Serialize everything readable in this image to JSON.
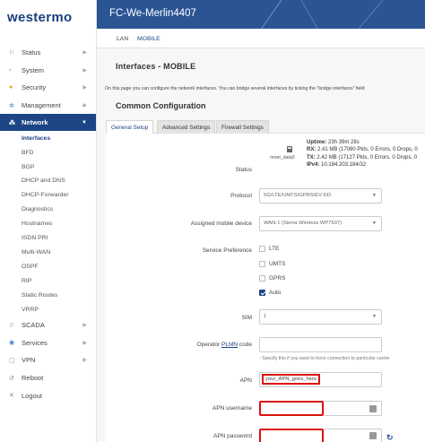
{
  "brand": "westermo",
  "header": {
    "hostname": "FC-We-Merlin4407"
  },
  "top_tabs": [
    "LAN",
    "MOBILE"
  ],
  "sidebar": {
    "items": [
      {
        "label": "Status",
        "icon": "status-icon",
        "glyph": "⚐"
      },
      {
        "label": "System",
        "icon": "system-icon",
        "glyph": "▫"
      },
      {
        "label": "Security",
        "icon": "security-icon",
        "glyph": "●"
      },
      {
        "label": "Management",
        "icon": "management-icon",
        "glyph": "✲"
      },
      {
        "label": "Network",
        "icon": "network-icon",
        "glyph": "⁂"
      }
    ],
    "network_sub": [
      "Interfaces",
      "BFD",
      "BGP",
      "DHCP and DNS",
      "DHCP-Forwarder",
      "Diagnostics",
      "Hostnames",
      "ISDN PRI",
      "Multi-WAN",
      "OSPF",
      "RIP",
      "Static Routes",
      "VRRP"
    ],
    "items_after": [
      {
        "label": "SCADA",
        "icon": "scada-icon",
        "glyph": "♫"
      },
      {
        "label": "Services",
        "icon": "services-icon",
        "glyph": "◉"
      },
      {
        "label": "VPN",
        "icon": "vpn-icon",
        "glyph": "▢"
      },
      {
        "label": "Reboot",
        "icon": "reboot-icon",
        "glyph": "↺"
      },
      {
        "label": "Logout",
        "icon": "logout-icon",
        "glyph": "✕"
      }
    ]
  },
  "page": {
    "title": "Interfaces - MOBILE",
    "description": "On this page you can configure the network interfaces. You can bridge several interfaces by ticking the \"bridge interfaces\" field",
    "section": "Common Configuration"
  },
  "subtabs": [
    "General Setup",
    "Advanced Settings",
    "Firewall Settings"
  ],
  "status": {
    "label": "Status",
    "interface": "mnet_data0",
    "uptime_label": "Uptime:",
    "uptime": "23h 39m 28s",
    "rx_label": "RX:",
    "rx": "2.41 MB (17080 Pkts, 0 Errors, 0 Drops, 0",
    "tx_label": "TX:",
    "tx": "2.42 MB (17127 Pkts, 0 Errors, 0 Drops, 0",
    "ipv4_label": "IPv4:",
    "ipv4": "10.184.203.184/32"
  },
  "form": {
    "protocol_label": "Protocol",
    "protocol_value": "5G/LTE/UMTS/GPRS/EV-DO",
    "device_label": "Assigned mobile device",
    "device_value": "WAN-1 (Sierra Wireless WP7607)",
    "service_label": "Service Preference",
    "service_options": [
      {
        "label": "LTE",
        "checked": false
      },
      {
        "label": "UMTS",
        "checked": false
      },
      {
        "label": "GPRS",
        "checked": false
      },
      {
        "label": "Auto",
        "checked": true
      }
    ],
    "sim_label": "SIM",
    "sim_value": "1",
    "plmn_label_pre": "Operator",
    "plmn_label_link": "PLMN",
    "plmn_label_post": "code",
    "plmn_hint": "- Specify this if you want to force connection to particular carrier",
    "apn_label": "APN",
    "apn_value": "your_APN_goes_here",
    "apn_user_label": "APN username",
    "apn_pass_label": "APN password"
  }
}
